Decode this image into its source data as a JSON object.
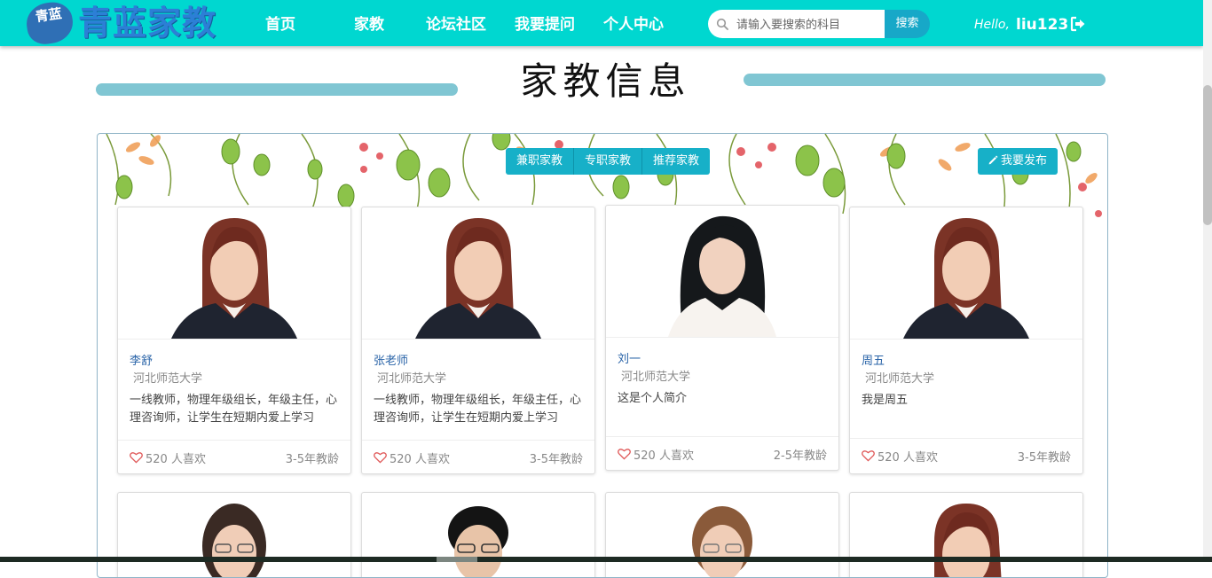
{
  "brand": {
    "badge_text": "青蓝",
    "name": "青蓝家教"
  },
  "nav": {
    "items": [
      {
        "label": "首页"
      },
      {
        "label": "家教"
      },
      {
        "label": "论坛社区"
      },
      {
        "label": "我要提问"
      },
      {
        "label": "个人中心"
      }
    ]
  },
  "search": {
    "placeholder": "请输入要搜索的科目",
    "button_label": "搜索"
  },
  "user": {
    "greeting": "Hello,",
    "username": "liu123"
  },
  "page": {
    "title": "家教信息"
  },
  "filters": {
    "tabs": [
      {
        "label": "兼职家教"
      },
      {
        "label": "专职家教"
      },
      {
        "label": "推荐家教"
      }
    ],
    "publish_label": "我要发布"
  },
  "tutors": [
    {
      "name": "李舒",
      "school": "河北师范大学",
      "intro": "一线教师，物理年级组长，年级主任，心理咨询师，让学生在短期内爱上学习",
      "likes": "520 人喜欢",
      "experience": "3-5年教龄"
    },
    {
      "name": "张老师",
      "school": "河北师范大学",
      "intro": "一线教师，物理年级组长，年级主任，心理咨询师，让学生在短期内爱上学习",
      "likes": "520 人喜欢",
      "experience": "3-5年教龄"
    },
    {
      "name": "刘一",
      "school": "河北师范大学",
      "intro": "这是个人简介",
      "likes": "520 人喜欢",
      "experience": "2-5年教龄"
    },
    {
      "name": "周五",
      "school": "河北师范大学",
      "intro": "我是周五",
      "likes": "520 人喜欢",
      "experience": "3-5年教龄"
    }
  ],
  "colors": {
    "navbar": "#00d7d0",
    "accent": "#17b0c8",
    "title_bar": "#80c6d3",
    "name_link": "#2a64a8",
    "heart": "#e05a5a"
  }
}
